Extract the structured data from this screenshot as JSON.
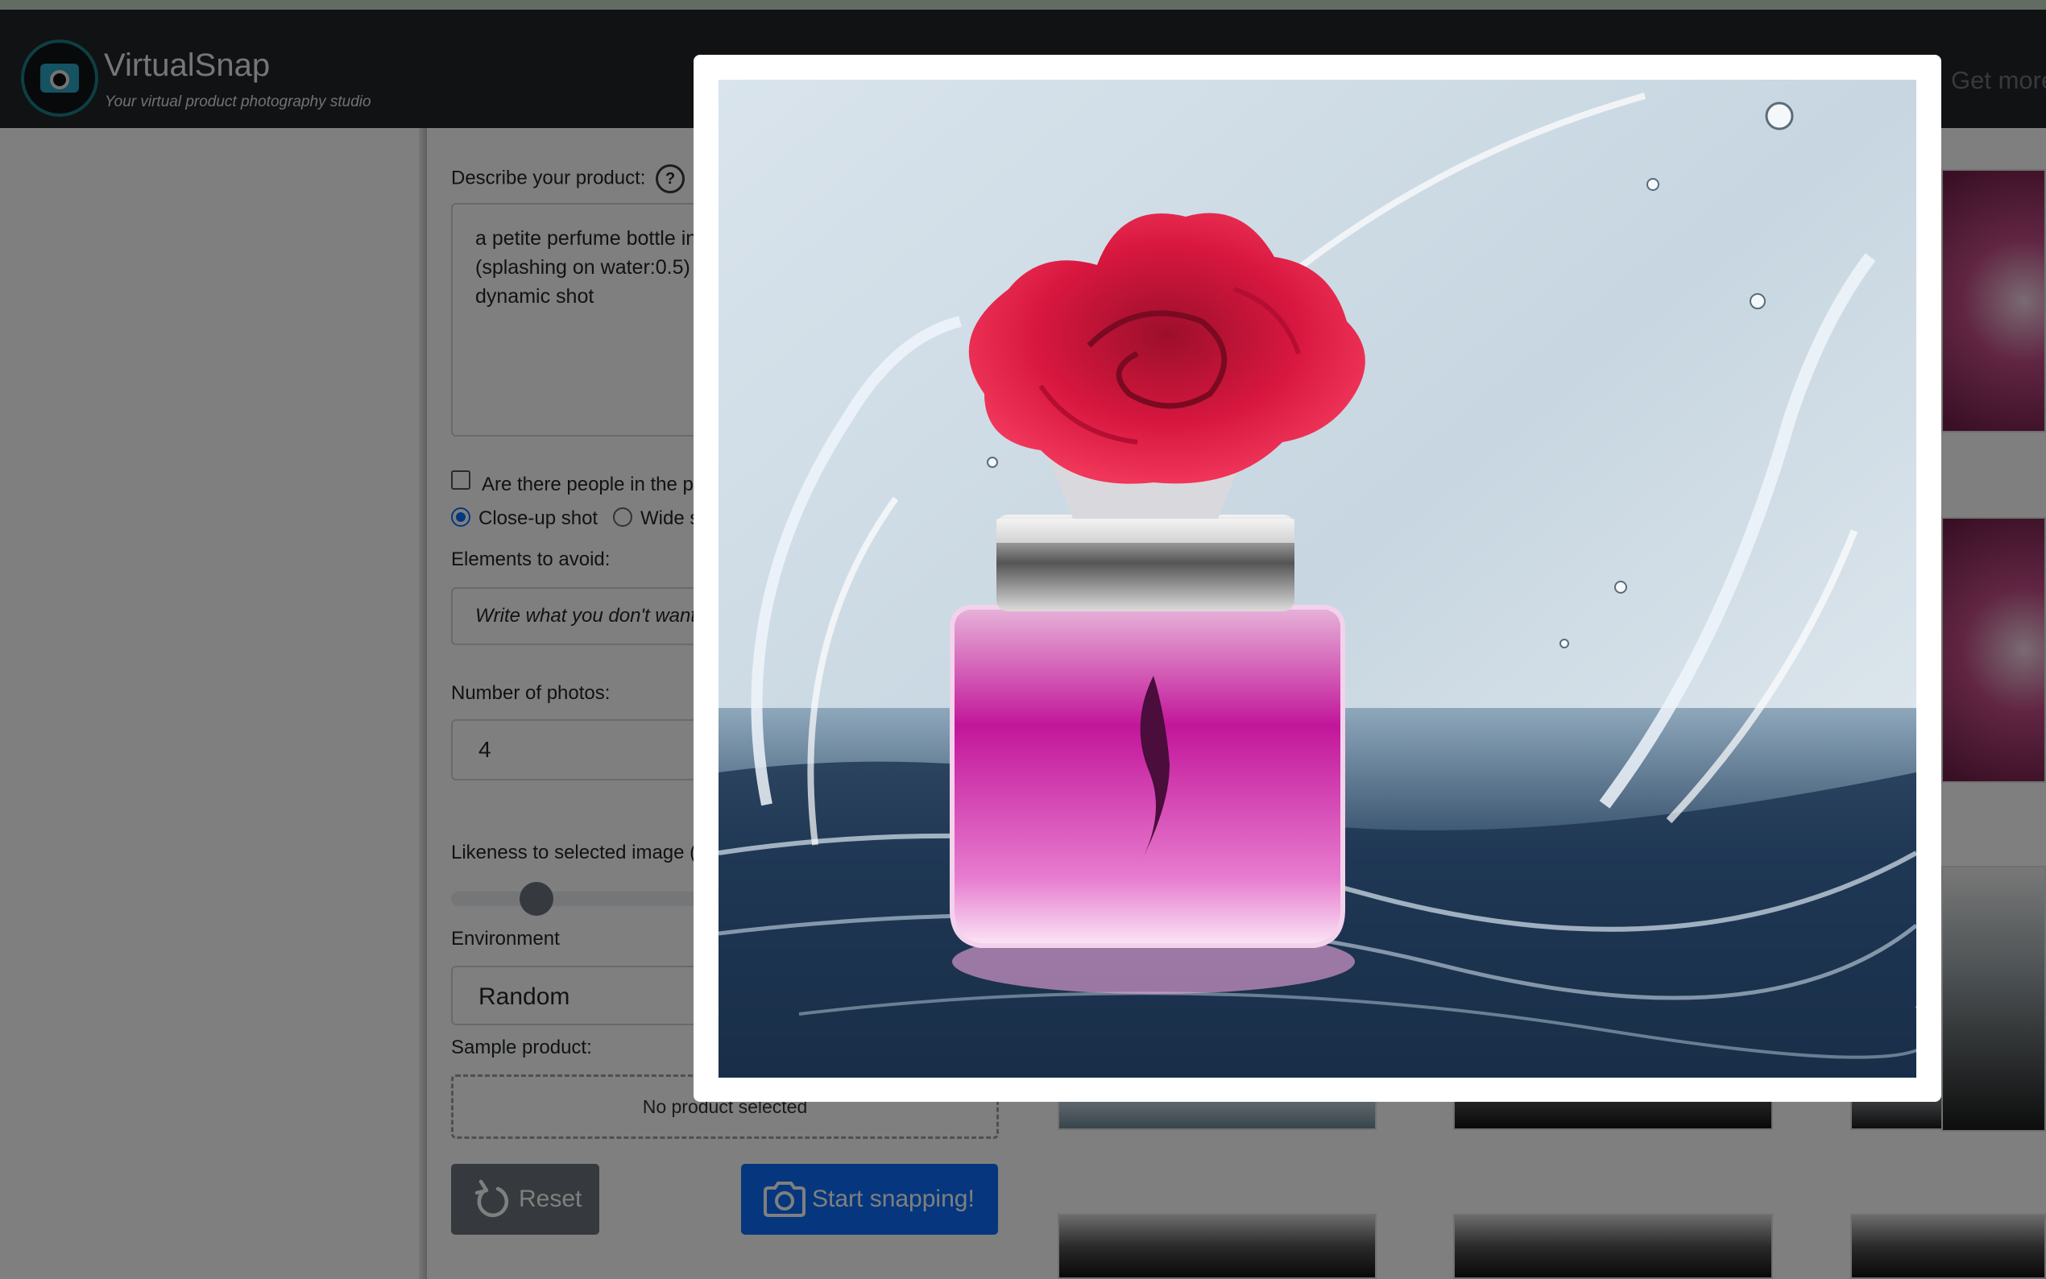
{
  "app": {
    "name": "VirtualSnap",
    "tagline": "Your virtual product photography studio",
    "nav_right": "Get more"
  },
  "form": {
    "describe_label": "Describe your product:",
    "help_icon": "?",
    "description_lines": [
      "a petite perfume bottle in",
      "(splashing on water:0.5)",
      "dynamic shot"
    ],
    "people_checkbox_label": "Are there people in the pi",
    "people_checked": false,
    "shot_options": [
      {
        "label": "Close-up shot",
        "selected": true
      },
      {
        "label": "Wide s",
        "selected": false
      }
    ],
    "avoid_label": "Elements to avoid:",
    "avoid_placeholder": "Write what you don't want i",
    "num_photos_label": "Number of photos:",
    "num_photos_value": "4",
    "likeness_label": "Likeness to selected image (m",
    "likeness_level": 0.2,
    "environment_label": "Environment",
    "environment_value": "Random",
    "sample_label": "Sample product:",
    "sample_empty": "No product selected",
    "reset_label": "Reset",
    "start_label": "Start snapping!"
  },
  "colors": {
    "navbar": "#212529",
    "primary": "#0d6efd",
    "secondary": "#6c757d",
    "modal_backdrop": "rgba(0,0,0,0.5)"
  },
  "modal": {
    "image_subject": "magenta perfume bottle with red rose cap splashing in water"
  }
}
